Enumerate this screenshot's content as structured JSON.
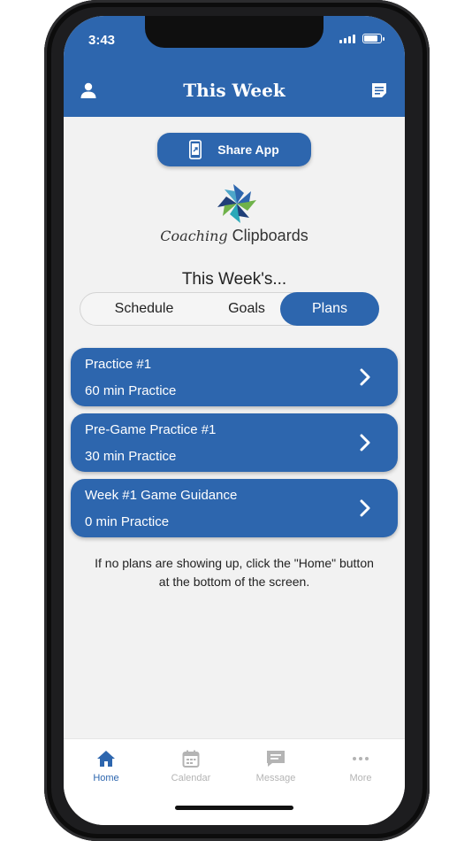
{
  "status_bar": {
    "time": "3:43"
  },
  "header": {
    "title": "This Week",
    "left_icon": "user-icon",
    "right_icon": "note-icon"
  },
  "share": {
    "label": "Share App",
    "icon": "share-phone-icon"
  },
  "brand": {
    "script": "Coaching",
    "name": "Clipboards"
  },
  "section": {
    "title": "This Week's..."
  },
  "segments": [
    {
      "label": "Schedule",
      "selected": false
    },
    {
      "label": "Goals",
      "selected": false
    },
    {
      "label": "Plans",
      "selected": true
    }
  ],
  "plans": [
    {
      "title": "Practice #1",
      "subtitle": "60 min Practice"
    },
    {
      "title": "Pre-Game Practice #1",
      "subtitle": "30 min Practice"
    },
    {
      "title": "Week #1 Game Guidance",
      "subtitle": "0 min Practice"
    }
  ],
  "note": {
    "line1": "If no plans are showing up, click the \"Home\" button",
    "line2": "at the bottom of the screen."
  },
  "tabs": [
    {
      "label": "Home",
      "icon": "home-icon",
      "active": true
    },
    {
      "label": "Calendar",
      "icon": "calendar-icon",
      "active": false
    },
    {
      "label": "Message",
      "icon": "message-icon",
      "active": false
    },
    {
      "label": "More",
      "icon": "more-icon",
      "active": false
    }
  ],
  "colors": {
    "primary": "#2d66ae",
    "background": "#f2f2f2",
    "inactive": "#b4b4b4"
  }
}
